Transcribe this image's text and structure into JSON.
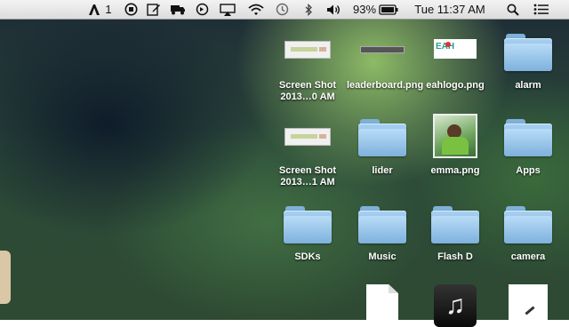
{
  "menubar": {
    "input_source": "1",
    "battery_percent": "93%",
    "datetime": "Tue 11:37 AM",
    "icons": [
      "adobe-icon",
      "record-stop-icon",
      "edit-pencil-icon",
      "truck-icon",
      "sync-icon",
      "airplay-icon",
      "wifi-icon",
      "time-machine-icon",
      "bluetooth-icon",
      "volume-icon",
      "battery-icon",
      "spotlight-search-icon",
      "notification-center-icon"
    ]
  },
  "desktop": {
    "items": [
      {
        "label": "Screen Shot 2013…0 AM",
        "kind": "screenshot"
      },
      {
        "label": "leaderboard.png",
        "kind": "image"
      },
      {
        "label": "eahlogo.png",
        "kind": "image"
      },
      {
        "label": "alarm",
        "kind": "folder"
      },
      {
        "label": "Screen Shot 2013…1 AM",
        "kind": "screenshot"
      },
      {
        "label": "lider",
        "kind": "folder"
      },
      {
        "label": "emma.png",
        "kind": "image"
      },
      {
        "label": "Apps",
        "kind": "folder"
      },
      {
        "label": "SDKs",
        "kind": "folder"
      },
      {
        "label": "Music",
        "kind": "folder"
      },
      {
        "label": "Flash D",
        "kind": "folder"
      },
      {
        "label": "camera",
        "kind": "folder"
      },
      {
        "label": "",
        "kind": "document"
      },
      {
        "label": "",
        "kind": "itunes"
      },
      {
        "label": "",
        "kind": "paper"
      }
    ]
  },
  "colors": {
    "folder": "#8fc0e8",
    "menubar": "#e8e8e8",
    "label_text": "#ffffff"
  }
}
